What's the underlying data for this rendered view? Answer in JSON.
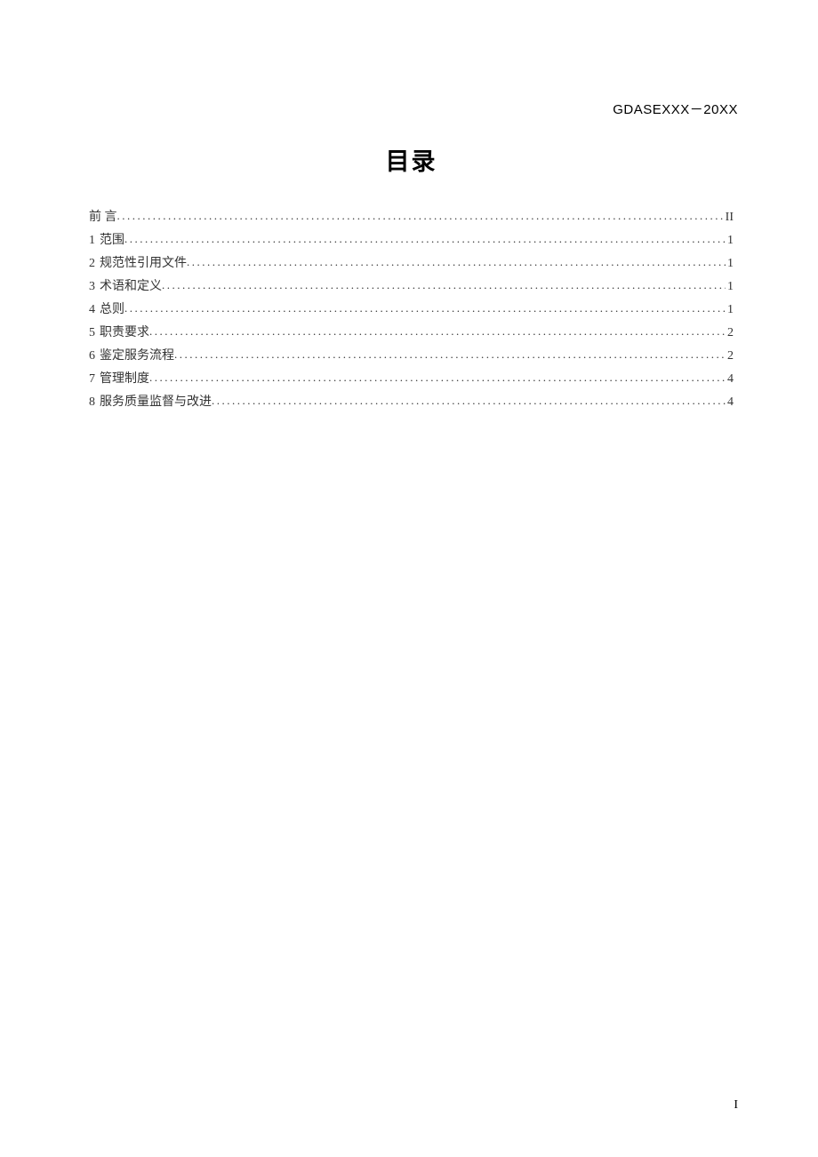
{
  "header": {
    "code": "GDASEXXX－20XX"
  },
  "title": "目录",
  "toc": {
    "preface": {
      "label": "前    言",
      "page": "II"
    },
    "entries": [
      {
        "num": "1",
        "label": "范围",
        "page": "1"
      },
      {
        "num": "2",
        "label": "规范性引用文件",
        "page": "1"
      },
      {
        "num": "3",
        "label": "术语和定义",
        "page": "1"
      },
      {
        "num": "4",
        "label": "总则",
        "page": "1"
      },
      {
        "num": "5",
        "label": "职责要求",
        "page": "2"
      },
      {
        "num": "6",
        "label": "鉴定服务流程",
        "page": "2"
      },
      {
        "num": "7",
        "label": "管理制度",
        "page": "4"
      },
      {
        "num": "8",
        "label": "服务质量监督与改进",
        "page": "4"
      }
    ]
  },
  "pageNumber": "I"
}
